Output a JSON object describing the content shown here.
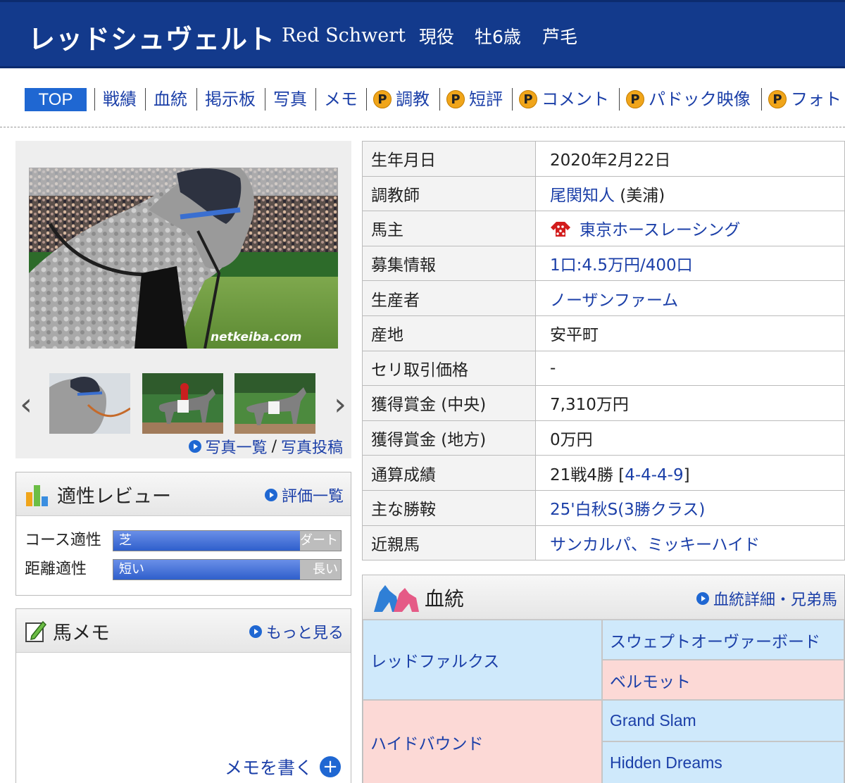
{
  "header": {
    "name_ja": "レッドシュヴェルト",
    "name_en": "Red Schwert",
    "status": "現役",
    "sex_age": "牡6歳",
    "color": "芦毛"
  },
  "nav": {
    "top": "TOP",
    "items": [
      "戦績",
      "血統",
      "掲示板",
      "写真",
      "メモ"
    ],
    "premium_items": [
      "調教",
      "短評",
      "コメント",
      "パドック映像",
      "フォト"
    ],
    "premium_icon": "P"
  },
  "photos": {
    "watermark": "netkeiba.com",
    "list_link": "写真一覧",
    "divider": "/",
    "post_link": "写真投稿"
  },
  "review": {
    "title": "適性レビュー",
    "link": "評価一覧",
    "rows": [
      {
        "label": "コース適性",
        "left": "芝",
        "right": "ダート",
        "level": 0.82
      },
      {
        "label": "距離適性",
        "left": "短い",
        "right": "長い",
        "level": 0.82
      }
    ]
  },
  "memo": {
    "title": "馬メモ",
    "more_link": "もっと見る",
    "write_link": "メモを書く"
  },
  "profile": {
    "rows": [
      {
        "key": "生年月日",
        "value": "2020年2月22日"
      },
      {
        "key": "調教師",
        "link": "尾関知人",
        "suffix": " (美浦)"
      },
      {
        "key": "馬主",
        "link": "東京ホースレーシング"
      },
      {
        "key": "募集情報",
        "link": "1口:4.5万円/400口"
      },
      {
        "key": "生産者",
        "link": "ノーザンファーム"
      },
      {
        "key": "産地",
        "value": "安平町"
      },
      {
        "key": "セリ取引価格",
        "value": "-"
      },
      {
        "key": "獲得賞金 (中央)",
        "value": "7,310万円"
      },
      {
        "key": "獲得賞金 (地方)",
        "value": "0万円"
      },
      {
        "key": "通算成績",
        "prefix": "21戦4勝 [",
        "link": "4-4-4-9",
        "suffix": "]"
      },
      {
        "key": "主な勝鞍",
        "link": "25'白秋S(3勝クラス)"
      },
      {
        "key": "近親馬",
        "link": "サンカルパ、ミッキーハイド"
      }
    ]
  },
  "pedigree": {
    "title": "血統",
    "link": "血統詳細・兄弟馬",
    "sire": "レッドファルクス",
    "sire_sire": "スウェプトオーヴァーボード",
    "sire_dam": "ベルモット",
    "dam": "ハイドバウンド",
    "dam_sire": "Grand Slam",
    "dam_dam": "Hidden Dreams"
  },
  "colors": {
    "header_bg": "#133a8c",
    "link": "#1b3fa8",
    "tab_active": "#1f67d2",
    "male_bg": "#cfe9fb",
    "female_bg": "#fcd9d6"
  }
}
